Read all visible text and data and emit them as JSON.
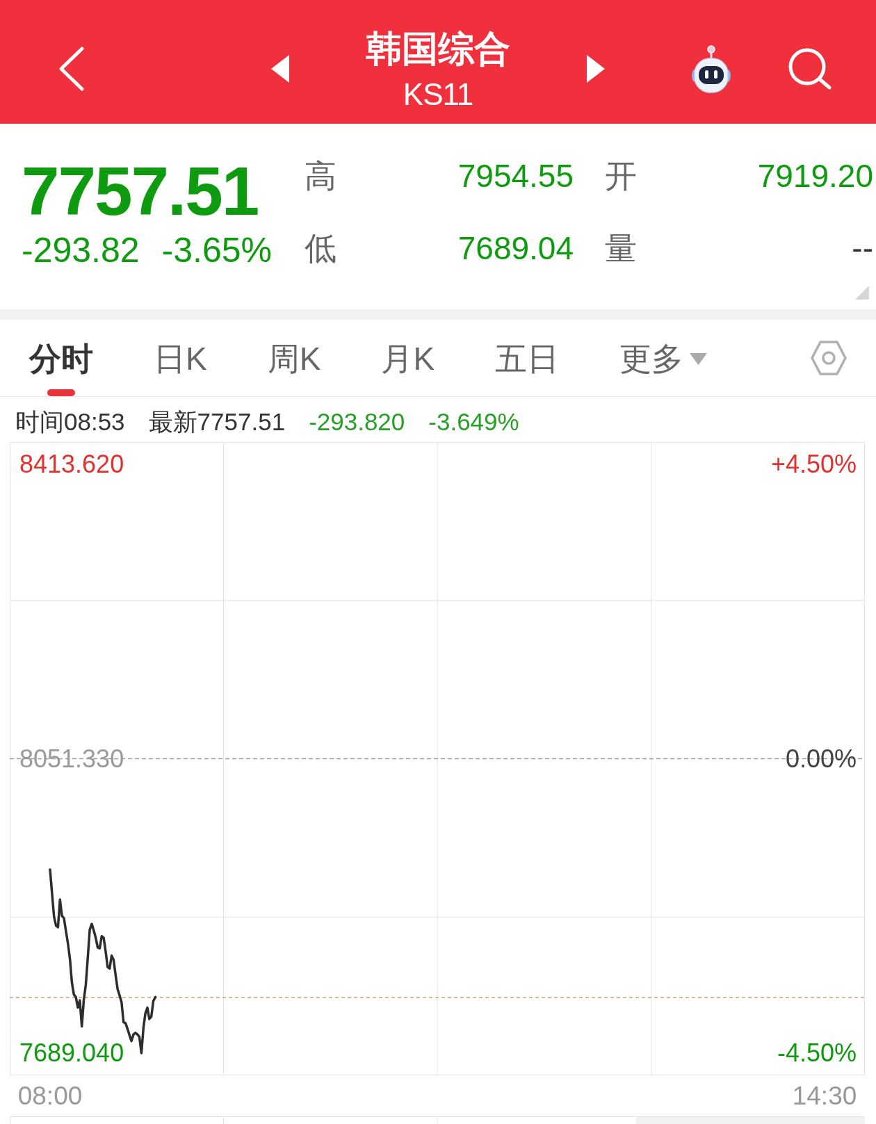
{
  "header": {
    "title": "韩国综合",
    "code": "KS11"
  },
  "quote": {
    "falling": true,
    "price": "7757.51",
    "change": "-293.82",
    "change_pct": "-3.65%",
    "stats": [
      {
        "label": "高",
        "value": "7954.55",
        "color": "#0f9b0f"
      },
      {
        "label": "开",
        "value": "7919.20",
        "color": "#0f9b0f"
      },
      {
        "label": "低",
        "value": "7689.04",
        "color": "#0f9b0f"
      },
      {
        "label": "量",
        "value": "--",
        "color": "#333333"
      }
    ]
  },
  "tabs": [
    {
      "label": "分时",
      "selected": true,
      "kind": "tab"
    },
    {
      "label": "日K",
      "selected": false,
      "kind": "tab"
    },
    {
      "label": "周K",
      "selected": false,
      "kind": "tab"
    },
    {
      "label": "月K",
      "selected": false,
      "kind": "tab"
    },
    {
      "label": "五日",
      "selected": false,
      "kind": "tab"
    },
    {
      "label": "更多",
      "selected": false,
      "kind": "menu"
    }
  ],
  "info": {
    "time": "时间08:53",
    "latest": "最新7757.51",
    "falling": true,
    "change": "-293.820",
    "change_pct": "-3.649%"
  },
  "chart": {
    "right_labels": [
      "+4.50%",
      "0.00%",
      "-4.50%"
    ],
    "chart_data": {
      "type": "line",
      "categories": [
        "08:00",
        null,
        null,
        null,
        null,
        null,
        null,
        null,
        null,
        null,
        null,
        null,
        null,
        null,
        null,
        null,
        null,
        null,
        null,
        null,
        null,
        null,
        null,
        null,
        null,
        null,
        null,
        null,
        null,
        null,
        null,
        null,
        null,
        null,
        null,
        null,
        null,
        null,
        null,
        null,
        null,
        null,
        null,
        null,
        null,
        null,
        null,
        null,
        null,
        null,
        null,
        null,
        null,
        null,
        null,
        null,
        null,
        null,
        null,
        null,
        null,
        null,
        null,
        null,
        null,
        null,
        null,
        null,
        null,
        null,
        null,
        null,
        null,
        null,
        null,
        null,
        null,
        null,
        null,
        null,
        null,
        null,
        null,
        null,
        null,
        null,
        null,
        null,
        null,
        null,
        null,
        null,
        null,
        null,
        null,
        null,
        null,
        null,
        null,
        null,
        null,
        null,
        null,
        null,
        null,
        null,
        null,
        null,
        null,
        null,
        null,
        null,
        null,
        null,
        null,
        null,
        null,
        null,
        null,
        null,
        null,
        null,
        null,
        null,
        null,
        null,
        null,
        null,
        null,
        null,
        null,
        null,
        null,
        null,
        null,
        null,
        null,
        null,
        null,
        null,
        null,
        null,
        null,
        null,
        null,
        null,
        null,
        null,
        null,
        null,
        null,
        null,
        null,
        null,
        null,
        null,
        null,
        null,
        null,
        null,
        null,
        null,
        null,
        null,
        null,
        null,
        null,
        null,
        null,
        null,
        null,
        null,
        null,
        null,
        null,
        null,
        null,
        null,
        null,
        null,
        null,
        null,
        null,
        null,
        null,
        null,
        null,
        null,
        null,
        null,
        null,
        null,
        null,
        null,
        null,
        null,
        null,
        null,
        null,
        null,
        null,
        null,
        null,
        null,
        null,
        null,
        null,
        null,
        null,
        null,
        null,
        null,
        null,
        null,
        null,
        null,
        null,
        null,
        null,
        null,
        null,
        null,
        null,
        null,
        null,
        null,
        null,
        null,
        null,
        null,
        null,
        null,
        null,
        null,
        null,
        null,
        null,
        null,
        null,
        null,
        null,
        null,
        null,
        null,
        null,
        null,
        null,
        null,
        null,
        null,
        null,
        null,
        null,
        null,
        null,
        null,
        null,
        null,
        null,
        null,
        null,
        null,
        null,
        null,
        null,
        null,
        null,
        null,
        null,
        null,
        null,
        null,
        null,
        null,
        null,
        null,
        null,
        null,
        null,
        null,
        null,
        null,
        null,
        null,
        null,
        null,
        null,
        null,
        null,
        null,
        null,
        null,
        null,
        null,
        null,
        null,
        null,
        null,
        null,
        null,
        null,
        null,
        null,
        null,
        null,
        null,
        null,
        null,
        null,
        null,
        null,
        null,
        null,
        null,
        null,
        null,
        null,
        null,
        null,
        null,
        null,
        null,
        null,
        null,
        null,
        null,
        null,
        null,
        null,
        null,
        null,
        null,
        null,
        null,
        null,
        null,
        null,
        null,
        null,
        null,
        null,
        null,
        null,
        null,
        null,
        null,
        null,
        null,
        null,
        null,
        null,
        null,
        null,
        null,
        null,
        null,
        null,
        null,
        null,
        null,
        null,
        null,
        null,
        null,
        null,
        null,
        null,
        null,
        null,
        null,
        null,
        null,
        null,
        null,
        null,
        null,
        null,
        null,
        null,
        null,
        null,
        null,
        null,
        null,
        null,
        null,
        null,
        null,
        null,
        null,
        "14:30"
      ],
      "values": [
        7915,
        7885,
        7857,
        7846,
        7844,
        7878,
        7858,
        7855,
        7839,
        7824,
        7805,
        7776,
        7761,
        7758,
        7745,
        7754,
        7722,
        7755,
        7773,
        7807,
        7841,
        7848,
        7840,
        7831,
        7819,
        7818,
        7833,
        7831,
        7814,
        7795,
        7793,
        7809,
        7804,
        7785,
        7768,
        7760,
        7752,
        7727,
        7726,
        7719,
        7711,
        7704,
        7712,
        7714,
        7712,
        7709,
        7689,
        7720,
        7738,
        7745,
        7731,
        7734,
        7753,
        7758,
        null,
        null,
        null,
        null,
        null,
        null,
        null,
        null,
        null,
        null,
        null,
        null,
        null,
        null,
        null,
        null,
        null,
        null,
        null,
        null,
        null,
        null,
        null,
        null,
        null,
        null,
        null,
        null,
        null,
        null,
        null,
        null,
        null,
        null,
        null,
        null,
        null,
        null,
        null,
        null,
        null,
        null,
        null,
        null,
        null,
        null,
        null,
        null,
        null,
        null,
        null,
        null,
        null,
        null,
        null,
        null,
        null,
        null,
        null,
        null,
        null,
        null,
        null,
        null,
        null,
        null,
        null,
        null,
        null,
        null,
        null,
        null,
        null,
        null,
        null,
        null,
        null,
        null,
        null,
        null,
        null,
        null,
        null,
        null,
        null,
        null,
        null,
        null,
        null,
        null,
        null,
        null,
        null,
        null,
        null,
        null,
        null,
        null,
        null,
        null,
        null,
        null,
        null,
        null,
        null,
        null,
        null,
        null,
        null,
        null,
        null,
        null,
        null,
        null,
        null,
        null,
        null,
        null,
        null,
        null,
        null,
        null,
        null,
        null,
        null,
        null,
        null,
        null,
        null,
        null,
        null,
        null,
        null,
        null,
        null,
        null,
        null,
        null,
        null,
        null,
        null,
        null,
        null,
        null,
        null,
        null,
        null,
        null,
        null,
        null,
        null,
        null,
        null,
        null,
        null,
        null,
        null,
        null,
        null,
        null,
        null,
        null,
        null,
        null,
        null,
        null,
        null,
        null,
        null,
        null,
        null,
        null,
        null,
        null,
        null,
        null,
        null,
        null,
        null,
        null,
        null,
        null,
        null,
        null,
        null,
        null,
        null,
        null,
        null,
        null,
        null,
        null,
        null,
        null,
        null,
        null,
        null,
        null,
        null,
        null,
        null,
        null,
        null,
        null,
        null,
        null,
        null,
        null,
        null,
        null,
        null,
        null,
        null,
        null,
        null,
        null,
        null,
        null,
        null,
        null,
        null,
        null,
        null,
        null,
        null,
        null,
        null,
        null,
        null,
        null,
        null,
        null,
        null,
        null,
        null,
        null,
        null,
        null,
        null,
        null,
        null,
        null,
        null,
        null,
        null,
        null,
        null,
        null,
        null,
        null,
        null,
        null,
        null,
        null,
        null,
        null,
        null,
        null,
        null,
        null,
        null,
        null,
        null,
        null,
        null,
        null,
        null,
        null,
        null,
        null,
        null,
        null,
        null,
        null,
        null,
        null,
        null,
        null,
        null,
        null,
        null,
        null,
        null,
        null,
        null,
        null,
        null,
        null,
        null,
        null,
        null,
        null,
        null,
        null,
        null,
        null,
        null,
        null,
        null,
        null,
        null,
        null,
        null,
        null,
        null,
        null,
        null,
        null,
        null,
        null,
        null,
        null,
        null,
        null,
        null,
        null,
        null,
        null,
        null,
        null,
        null,
        null,
        null,
        null,
        null,
        null,
        null,
        null,
        null,
        null,
        null,
        null,
        null,
        null,
        null,
        null,
        null
      ],
      "ylim": [
        7661.7,
        8441.0
      ],
      "yticks": [
        {
          "value": 8413.62,
          "label": "8413.620"
        },
        {
          "value": 8051.33,
          "label": "8051.330"
        },
        {
          "value": 7689.04,
          "label": "7689.040"
        }
      ],
      "ref_lines": [
        {
          "axis": "y",
          "value": 8051.33,
          "color": "#9a9a9a"
        },
        {
          "axis": "y",
          "value": 7757.51,
          "color": "#c9a47f"
        }
      ]
    }
  }
}
